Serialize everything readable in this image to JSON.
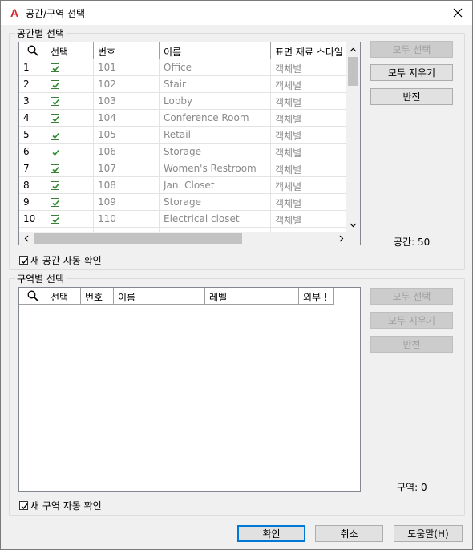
{
  "window": {
    "title": "공간/구역 선택"
  },
  "spaces": {
    "group_title": "공간별 선택",
    "columns": [
      "선택",
      "번호",
      "이름",
      "표면 재료 스타일"
    ],
    "rows": [
      {
        "index": "1",
        "checked": true,
        "number": "101",
        "name": "Office",
        "style": "객체별"
      },
      {
        "index": "2",
        "checked": true,
        "number": "102",
        "name": "Stair",
        "style": "객체별"
      },
      {
        "index": "3",
        "checked": true,
        "number": "103",
        "name": "Lobby",
        "style": "객체별"
      },
      {
        "index": "4",
        "checked": true,
        "number": "104",
        "name": "Conference Room",
        "style": "객체별"
      },
      {
        "index": "5",
        "checked": true,
        "number": "105",
        "name": "Retail",
        "style": "객체별"
      },
      {
        "index": "6",
        "checked": true,
        "number": "106",
        "name": "Storage",
        "style": "객체별"
      },
      {
        "index": "7",
        "checked": true,
        "number": "107",
        "name": "Women's Restroom",
        "style": "객체별"
      },
      {
        "index": "8",
        "checked": true,
        "number": "108",
        "name": "Jan. Closet",
        "style": "객체별"
      },
      {
        "index": "9",
        "checked": true,
        "number": "109",
        "name": "Storage",
        "style": "객체별"
      },
      {
        "index": "10",
        "checked": true,
        "number": "110",
        "name": "Electrical closet",
        "style": "객체별"
      }
    ],
    "buttons": {
      "select_all": "모두 선택",
      "clear_all": "모두 지우기",
      "invert": "반전"
    },
    "count_label": "공간: 50",
    "auto_check_label": "새 공간 자동 확인",
    "auto_check": true
  },
  "zones": {
    "group_title": "구역별 선택",
    "columns": [
      "선택",
      "번호",
      "이름",
      "레벨",
      "외부 !"
    ],
    "buttons": {
      "select_all": "모두 선택",
      "clear_all": "모두 지우기",
      "invert": "반전"
    },
    "count_label": "구역: 0",
    "auto_check_label": "새 구역 자동 확인",
    "auto_check": true
  },
  "footer": {
    "ok": "확인",
    "cancel": "취소",
    "help": "도움말(H)"
  }
}
